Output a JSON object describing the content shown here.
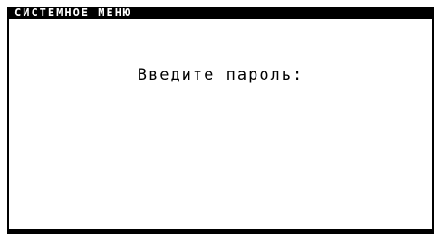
{
  "window": {
    "title": "СИСТЕМНОЕ МЕНЮ"
  },
  "main": {
    "prompt": "Введите пароль:"
  },
  "colors": {
    "frame": "#000000",
    "background": "#ffffff",
    "text": "#000000",
    "title_text": "#ffffff"
  }
}
